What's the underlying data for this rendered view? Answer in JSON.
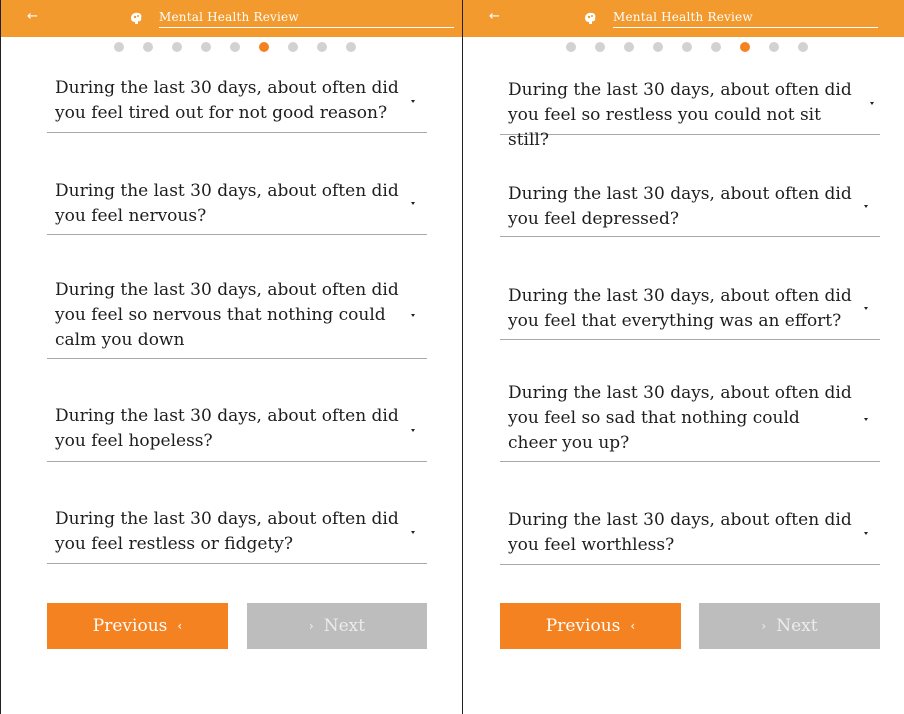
{
  "app": {
    "title": "Mental Health Review"
  },
  "icons": {
    "back": "←",
    "brain": "brain-icon",
    "caret": "caret-down-icon"
  },
  "colors": {
    "accent": "#f58220",
    "header": "#f29a2e",
    "dot_inactive": "#d2d2d2",
    "disabled": "#bdbdbd"
  },
  "panels": [
    {
      "progress": {
        "total": 9,
        "active_index": 5
      },
      "questions": [
        {
          "text": "During the last 30 days, about often did you feel tired out for not good reason?"
        },
        {
          "text": "During the last 30 days, about often did you feel nervous?"
        },
        {
          "text": "During the last 30 days, about often did you feel so nervous that nothing could calm you down"
        },
        {
          "text": "During the last 30 days, about often did you feel hopeless?"
        },
        {
          "text": "During the last 30 days, about often did you feel restless or fidgety?"
        }
      ],
      "buttons": {
        "previous": "Previous",
        "previous_icon": "‹",
        "next": "Next",
        "next_icon": "›"
      }
    },
    {
      "progress": {
        "total": 9,
        "active_index": 6
      },
      "questions": [
        {
          "text": "During the last 30 days, about often did you feel so restless you could not sit still?"
        },
        {
          "text": "During the last 30 days, about often did you feel depressed?"
        },
        {
          "text": "During the last 30 days, about often did you feel that everything was an effort?"
        },
        {
          "text": "During the last 30 days, about often did you feel so sad that nothing could cheer you up?"
        },
        {
          "text": "During the last 30 days, about often did you feel worthless?"
        }
      ],
      "buttons": {
        "previous": "Previous",
        "previous_icon": "‹",
        "next": "Next",
        "next_icon": "›"
      }
    }
  ]
}
